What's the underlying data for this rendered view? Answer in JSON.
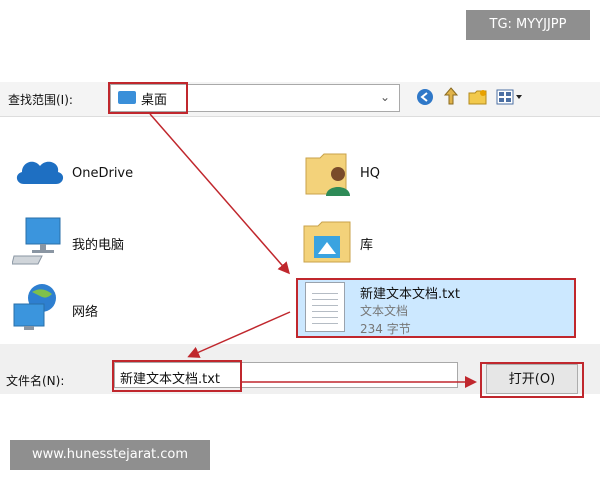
{
  "watermarks": {
    "top": "TG: MYYJJPP",
    "bottom": "www.hunesstejarat.com"
  },
  "look_in": {
    "label": "查找范围(I):",
    "value": "桌面"
  },
  "items": [
    {
      "label": "OneDrive",
      "icon": "cloud-icon"
    },
    {
      "label": "HQ",
      "icon": "user-folder-icon"
    },
    {
      "label": "我的电脑",
      "icon": "computer-icon"
    },
    {
      "label": "库",
      "icon": "library-folder-icon"
    },
    {
      "label": "网络",
      "icon": "network-icon"
    }
  ],
  "selected_file": {
    "name": "新建文本文档.txt",
    "type": "文本文档",
    "size": "234 字节"
  },
  "filename": {
    "label": "文件名(N):",
    "value": "新建文本文档.txt"
  },
  "open_button": "打开(O)",
  "colors": {
    "highlight": "#c0272d",
    "selection": "#cce8ff",
    "accent": "#3a8fd9"
  }
}
